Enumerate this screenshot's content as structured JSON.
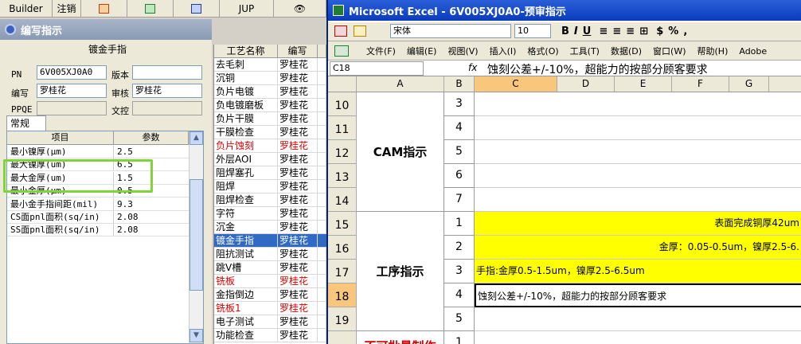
{
  "topbar": {
    "builder": "Builder",
    "logout": "注销",
    "jup": "JUP"
  },
  "left": {
    "title": "编写指示",
    "heading": "镀金手指",
    "pn_label": "PN",
    "pn_value": "6V005XJ0A0",
    "ver_label": "版本",
    "ver_value": "",
    "writer_label": "编写",
    "writer_value": "罗桂花",
    "review_label": "审核",
    "review_value": "罗桂花",
    "ppqe_label": "PPQE",
    "ppqe_value": "",
    "doc_label": "文控",
    "doc_value": "",
    "tab": "常规",
    "col_item": "项目",
    "col_param": "参数",
    "params": [
      {
        "k": "最小镍厚(μm)",
        "v": "2.5"
      },
      {
        "k": "最大镍厚(um)",
        "v": "6.5"
      },
      {
        "k": "最大金厚(um)",
        "v": "1.5"
      },
      {
        "k": "最小金厚(μm)",
        "v": "0.5"
      },
      {
        "k": "最小金手指间距(mil)",
        "v": "9.3"
      },
      {
        "k": "CS面pnl面积(sq/in)",
        "v": "2.08"
      },
      {
        "k": "SS面pnl面积(sq/in)",
        "v": "2.08"
      }
    ]
  },
  "mid": {
    "col1": "工艺名称",
    "col2": "编写",
    "rows": [
      {
        "n": "去毛刺",
        "w": "罗桂花",
        "s": "normal"
      },
      {
        "n": "沉铜",
        "w": "罗桂花",
        "s": "normal"
      },
      {
        "n": "负片电镀",
        "w": "罗桂花",
        "s": "normal"
      },
      {
        "n": "负电镀磨板",
        "w": "罗桂花",
        "s": "normal"
      },
      {
        "n": "负片干膜",
        "w": "罗桂花",
        "s": "normal"
      },
      {
        "n": "干膜检查",
        "w": "罗桂花",
        "s": "normal"
      },
      {
        "n": "负片蚀刻",
        "w": "罗桂花",
        "s": "red"
      },
      {
        "n": "外层AOI",
        "w": "罗桂花",
        "s": "normal"
      },
      {
        "n": "阻焊塞孔",
        "w": "罗桂花",
        "s": "normal"
      },
      {
        "n": "阻焊",
        "w": "罗桂花",
        "s": "normal"
      },
      {
        "n": "阻焊检查",
        "w": "罗桂花",
        "s": "normal"
      },
      {
        "n": "字符",
        "w": "罗桂花",
        "s": "normal"
      },
      {
        "n": "沉金",
        "w": "罗桂花",
        "s": "normal"
      },
      {
        "n": "镀金手指",
        "w": "罗桂花",
        "s": "sel"
      },
      {
        "n": "阻抗测试",
        "w": "罗桂花",
        "s": "normal"
      },
      {
        "n": "跳V槽",
        "w": "罗桂花",
        "s": "normal"
      },
      {
        "n": "铣板",
        "w": "罗桂花",
        "s": "red"
      },
      {
        "n": "金指倒边",
        "w": "罗桂花",
        "s": "normal"
      },
      {
        "n": "铣板1",
        "w": "罗桂花",
        "s": "red"
      },
      {
        "n": "电子测试",
        "w": "罗桂花",
        "s": "normal"
      },
      {
        "n": "功能检查",
        "w": "罗桂花",
        "s": "normal"
      }
    ]
  },
  "excel": {
    "title": "Microsoft Excel - 6V005XJ0A0-预审指示",
    "font": "宋体",
    "size": "10",
    "menu": [
      "文件(F)",
      "编辑(E)",
      "视图(V)",
      "插入(I)",
      "格式(O)",
      "工具(T)",
      "数据(D)",
      "窗口(W)",
      "帮助(H)",
      "Adobe"
    ],
    "namebox": "C18",
    "fx": "fx",
    "formula": "蚀刻公差+/-10%，超能力的按部分顾客要求",
    "cols": [
      "A",
      "B",
      "C",
      "D",
      "E",
      "F",
      "G"
    ],
    "group_cam": "CAM指示",
    "group_proc": "工序指示",
    "group_next": "不可批量制作",
    "rows": [
      {
        "r": "10",
        "b": "3",
        "c": "",
        "y": false
      },
      {
        "r": "11",
        "b": "4",
        "c": "",
        "y": false
      },
      {
        "r": "12",
        "b": "5",
        "c": "",
        "y": false
      },
      {
        "r": "13",
        "b": "6",
        "c": "",
        "y": false
      },
      {
        "r": "14",
        "b": "7",
        "c": "",
        "y": false
      },
      {
        "r": "15",
        "b": "1",
        "c": "表面完成铜厚42um",
        "y": true
      },
      {
        "r": "16",
        "b": "2",
        "c": "金厚：0.05-0.5um，镍厚2.5-6.",
        "y": true
      },
      {
        "r": "17",
        "b": "3",
        "c": "手指:金厚0.5-1.5um，镍厚2.5-6.5um",
        "y": true
      },
      {
        "r": "18",
        "b": "4",
        "c": "蚀刻公差+/-10%，超能力的按部分顾客要求",
        "y": false
      },
      {
        "r": "19",
        "b": "5",
        "c": "",
        "y": false
      },
      {
        "r": "",
        "b": "1",
        "c": "",
        "y": false
      }
    ]
  }
}
